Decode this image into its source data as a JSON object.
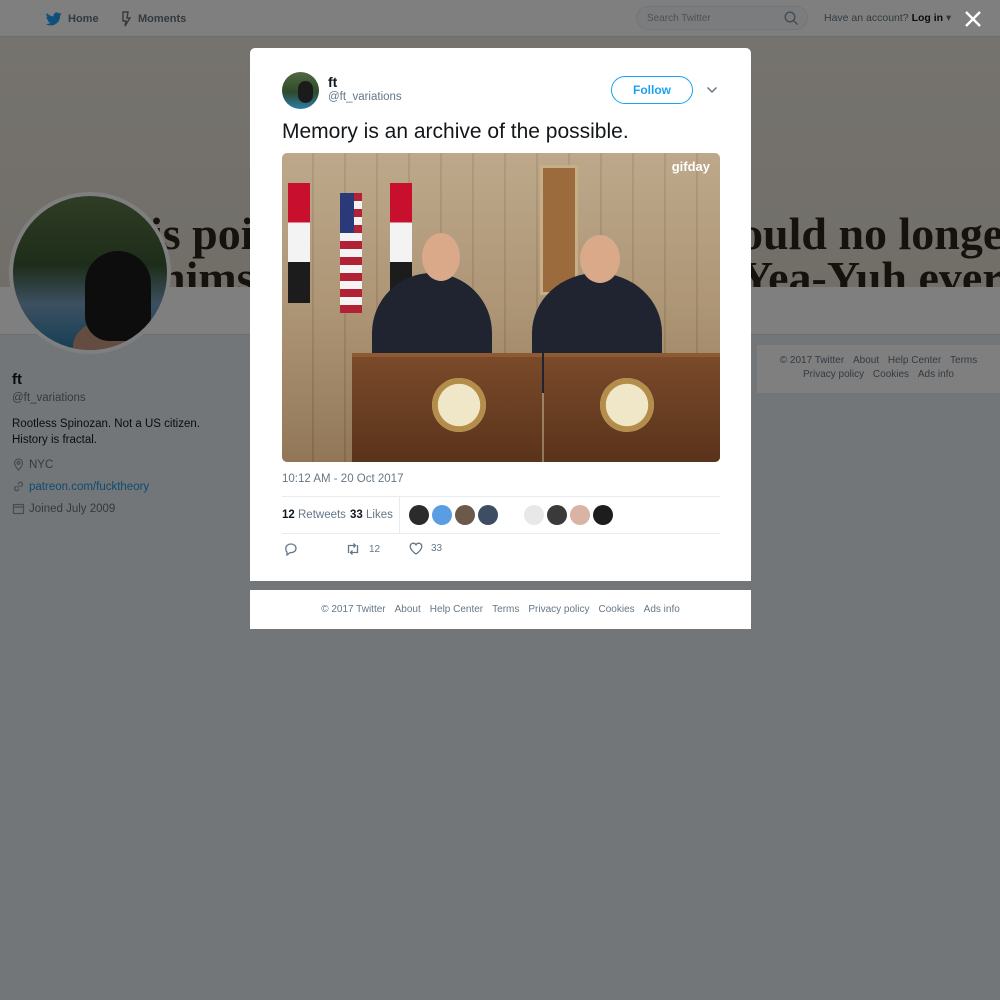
{
  "topbar": {
    "home_label": "Home",
    "moments_label": "Moments",
    "search_placeholder": "Search Twitter",
    "account_prompt": "Have an account?",
    "login_label": "Log in"
  },
  "banner": {
    "line1_left": "is poin",
    "line2_left": "himse",
    "line1_right": "ould no longer",
    "line2_right": "Yea-Yuh   ever"
  },
  "profile": {
    "name": "ft",
    "handle": "@ft_variations",
    "bio": "Rootless Spinozan. Not a US citizen. History is fractal.",
    "location": "NYC",
    "link": "patreon.com/fucktheory",
    "joined": "Joined July 2009"
  },
  "side_footer": {
    "line1": [
      "© 2017 Twitter",
      "About",
      "Help Center",
      "Terms"
    ],
    "line2": [
      "Privacy policy",
      "Cookies",
      "Ads info"
    ]
  },
  "tweet": {
    "name": "ft",
    "handle": "@ft_variations",
    "follow_label": "Follow",
    "text": "Memory is an archive of the possible.",
    "media_watermark": "gifday",
    "timestamp": "10:12 AM - 20 Oct 2017",
    "retweets_count": "12",
    "retweets_label": "Retweets",
    "likes_count": "33",
    "likes_label": "Likes",
    "liker_colors": [
      "#2b2b2b",
      "#5b9de3",
      "#6b5a4a",
      "#3d4e62",
      "#ffffff",
      "#e8e8e8",
      "#3a3a3a",
      "#d9b3a3",
      "#1d1d1d"
    ],
    "action_retweet_count": "12",
    "action_like_count": "33"
  },
  "modal_footer": [
    "© 2017 Twitter",
    "About",
    "Help Center",
    "Terms",
    "Privacy policy",
    "Cookies",
    "Ads info"
  ],
  "colors": {
    "accent": "#1da1f2",
    "link": "#1b95e0",
    "overlay": "rgba(0,0,0,0.5)"
  }
}
